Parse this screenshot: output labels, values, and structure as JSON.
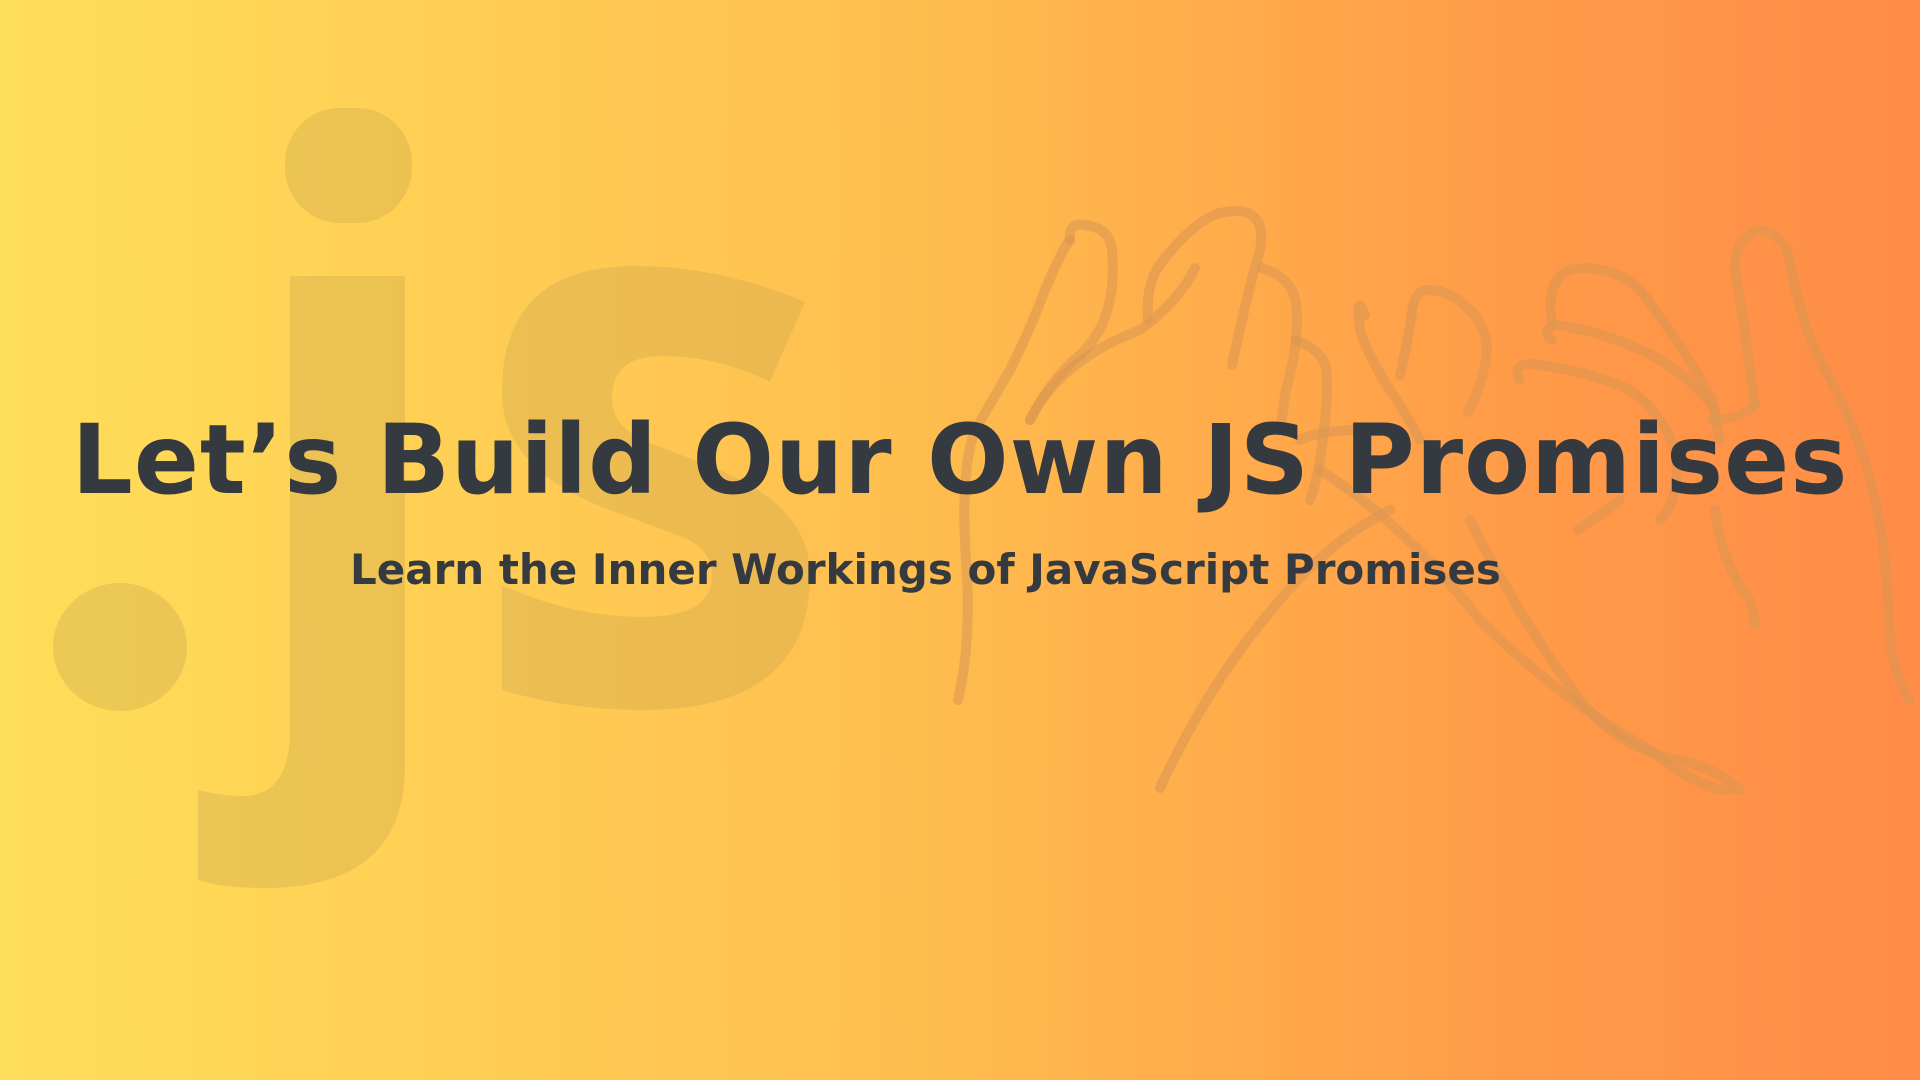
{
  "background": {
    "gradient_start": "#FFDE59",
    "gradient_end": "#FF8C47",
    "watermark_text": ".js",
    "watermark_color": "#D6B35A",
    "hands_line_color": "#E09A55"
  },
  "title": "Let’s Build Our Own JS Promises",
  "subtitle": "Learn the Inner Workings of JavaScript Promises",
  "text_color": "#353A40",
  "decorations": {
    "watermark_icon": "js-watermark",
    "illustration_icon": "pinky-promise-hands-icon"
  }
}
